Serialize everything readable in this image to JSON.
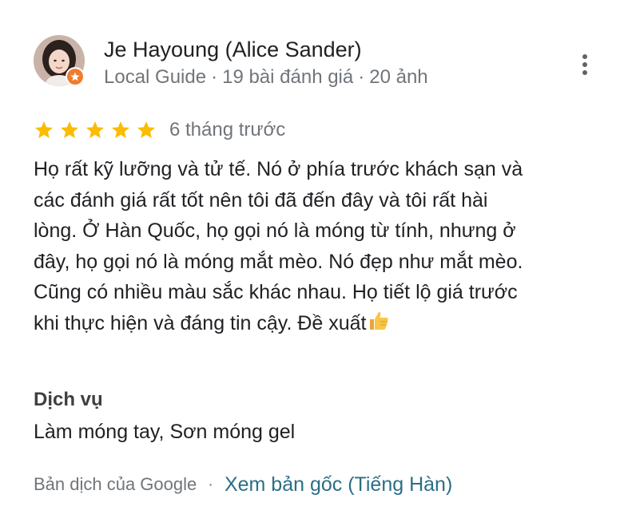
{
  "reviewer": {
    "name": "Je Hayoung (Alice Sander)",
    "badge_label": "Local Guide",
    "reviews_count": "19 bài đánh giá",
    "photos_count": "20 ảnh",
    "separator": "·"
  },
  "review": {
    "rating": 5,
    "rating_max": 5,
    "date": "6 tháng trước",
    "text": "Họ rất kỹ lưỡng và tử tế. Nó ở phía trước khách sạn và\ncác đánh giá rất tốt nên tôi đã đến đây và tôi rất hài\nlòng. Ở Hàn Quốc, họ gọi nó là móng từ tính, nhưng ở\nđây, họ gọi nó là móng mắt mèo. Nó đẹp như mắt mèo.\nCũng có nhiều màu sắc khác nhau. Họ tiết lộ giá trước\nkhi thực hiện và đáng tin cậy. Đề xuất",
    "emoji": "thumbs-up"
  },
  "services": {
    "title": "Dịch vụ",
    "value": "Làm móng tay, Sơn móng gel"
  },
  "translation": {
    "note": "Bản dịch của Google",
    "separator": "·",
    "link_label": "Xem bản gốc (Tiếng Hàn)"
  },
  "colors": {
    "star": "#fbbc04",
    "secondary_text": "#70757a",
    "link": "#2b6e86",
    "local_guide_badge": "#f07c2e"
  },
  "icons": {
    "more": "more-vertical-icon",
    "star": "star-icon",
    "badge": "local-guide-badge-icon",
    "emoji": "thumbs-up-icon"
  }
}
